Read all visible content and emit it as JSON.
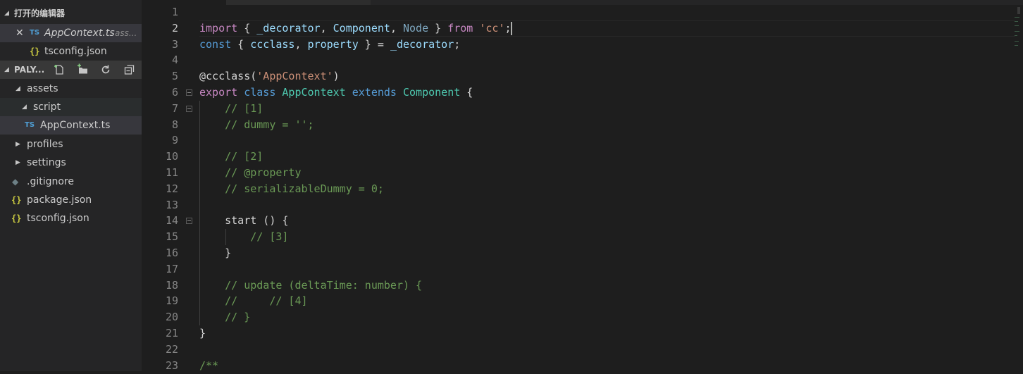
{
  "sidebar": {
    "open_editors_title": "打开的编辑器",
    "open_editors": [
      {
        "badge": "TS",
        "name": "AppContext.ts",
        "path": "ass..."
      },
      {
        "badge": "{}",
        "name": "tsconfig.json"
      }
    ],
    "project_title": "PALY...",
    "toolbar": [
      "new-file-icon",
      "new-folder-icon",
      "refresh-icon",
      "collapse-all-icon"
    ],
    "tree": [
      {
        "label": "assets",
        "kind": "folder",
        "expanded": true
      },
      {
        "label": "script",
        "kind": "folder",
        "expanded": true
      },
      {
        "label": "AppContext.ts",
        "kind": "ts-file"
      },
      {
        "label": "profiles",
        "kind": "folder",
        "expanded": false
      },
      {
        "label": "settings",
        "kind": "folder",
        "expanded": false
      },
      {
        "label": ".gitignore",
        "kind": "git-file"
      },
      {
        "label": "package.json",
        "kind": "json-file"
      },
      {
        "label": "tsconfig.json",
        "kind": "json-file"
      }
    ]
  },
  "editor": {
    "current_line": 2,
    "line_numbers": [
      "1",
      "2",
      "3",
      "4",
      "5",
      "6",
      "7",
      "8",
      "9",
      "10",
      "11",
      "12",
      "13",
      "14",
      "15",
      "16",
      "17",
      "18",
      "19",
      "20",
      "21",
      "22",
      "23"
    ],
    "code": {
      "l2": [
        "import",
        " { ",
        "_decorator",
        ", ",
        "Component",
        ", ",
        "Node",
        " } ",
        "from",
        " ",
        "'cc'",
        ";"
      ],
      "l3": [
        "const",
        " { ",
        "ccclass",
        ", ",
        "property",
        " } = ",
        "_decorator",
        ";"
      ],
      "l5": [
        "@ccclass(",
        "'AppContext'",
        ")"
      ],
      "l6": [
        "export",
        " ",
        "class",
        " ",
        "AppContext",
        " ",
        "extends",
        " ",
        "Component",
        " {"
      ],
      "l7": "    // [1]",
      "l8": "    // dummy = '';",
      "l10": "    // [2]",
      "l11": "    // @property",
      "l12": "    // serializableDummy = 0;",
      "l14": "    start () {",
      "l15": "        // [3]",
      "l16": "    }",
      "l18": "    // update (deltaTime: number) {",
      "l19": "    //     // [4]",
      "l20": "    // }",
      "l21": "}",
      "l23": "/**"
    }
  },
  "colors": {
    "keyword": "#c586c0",
    "storage": "#569cd6",
    "variable": "#9cdcfe",
    "type": "#4ec9b0",
    "string": "#ce9178",
    "comment": "#6a9955",
    "ts_badge": "#4f9fd5",
    "json_badge": "#cbcb41"
  }
}
